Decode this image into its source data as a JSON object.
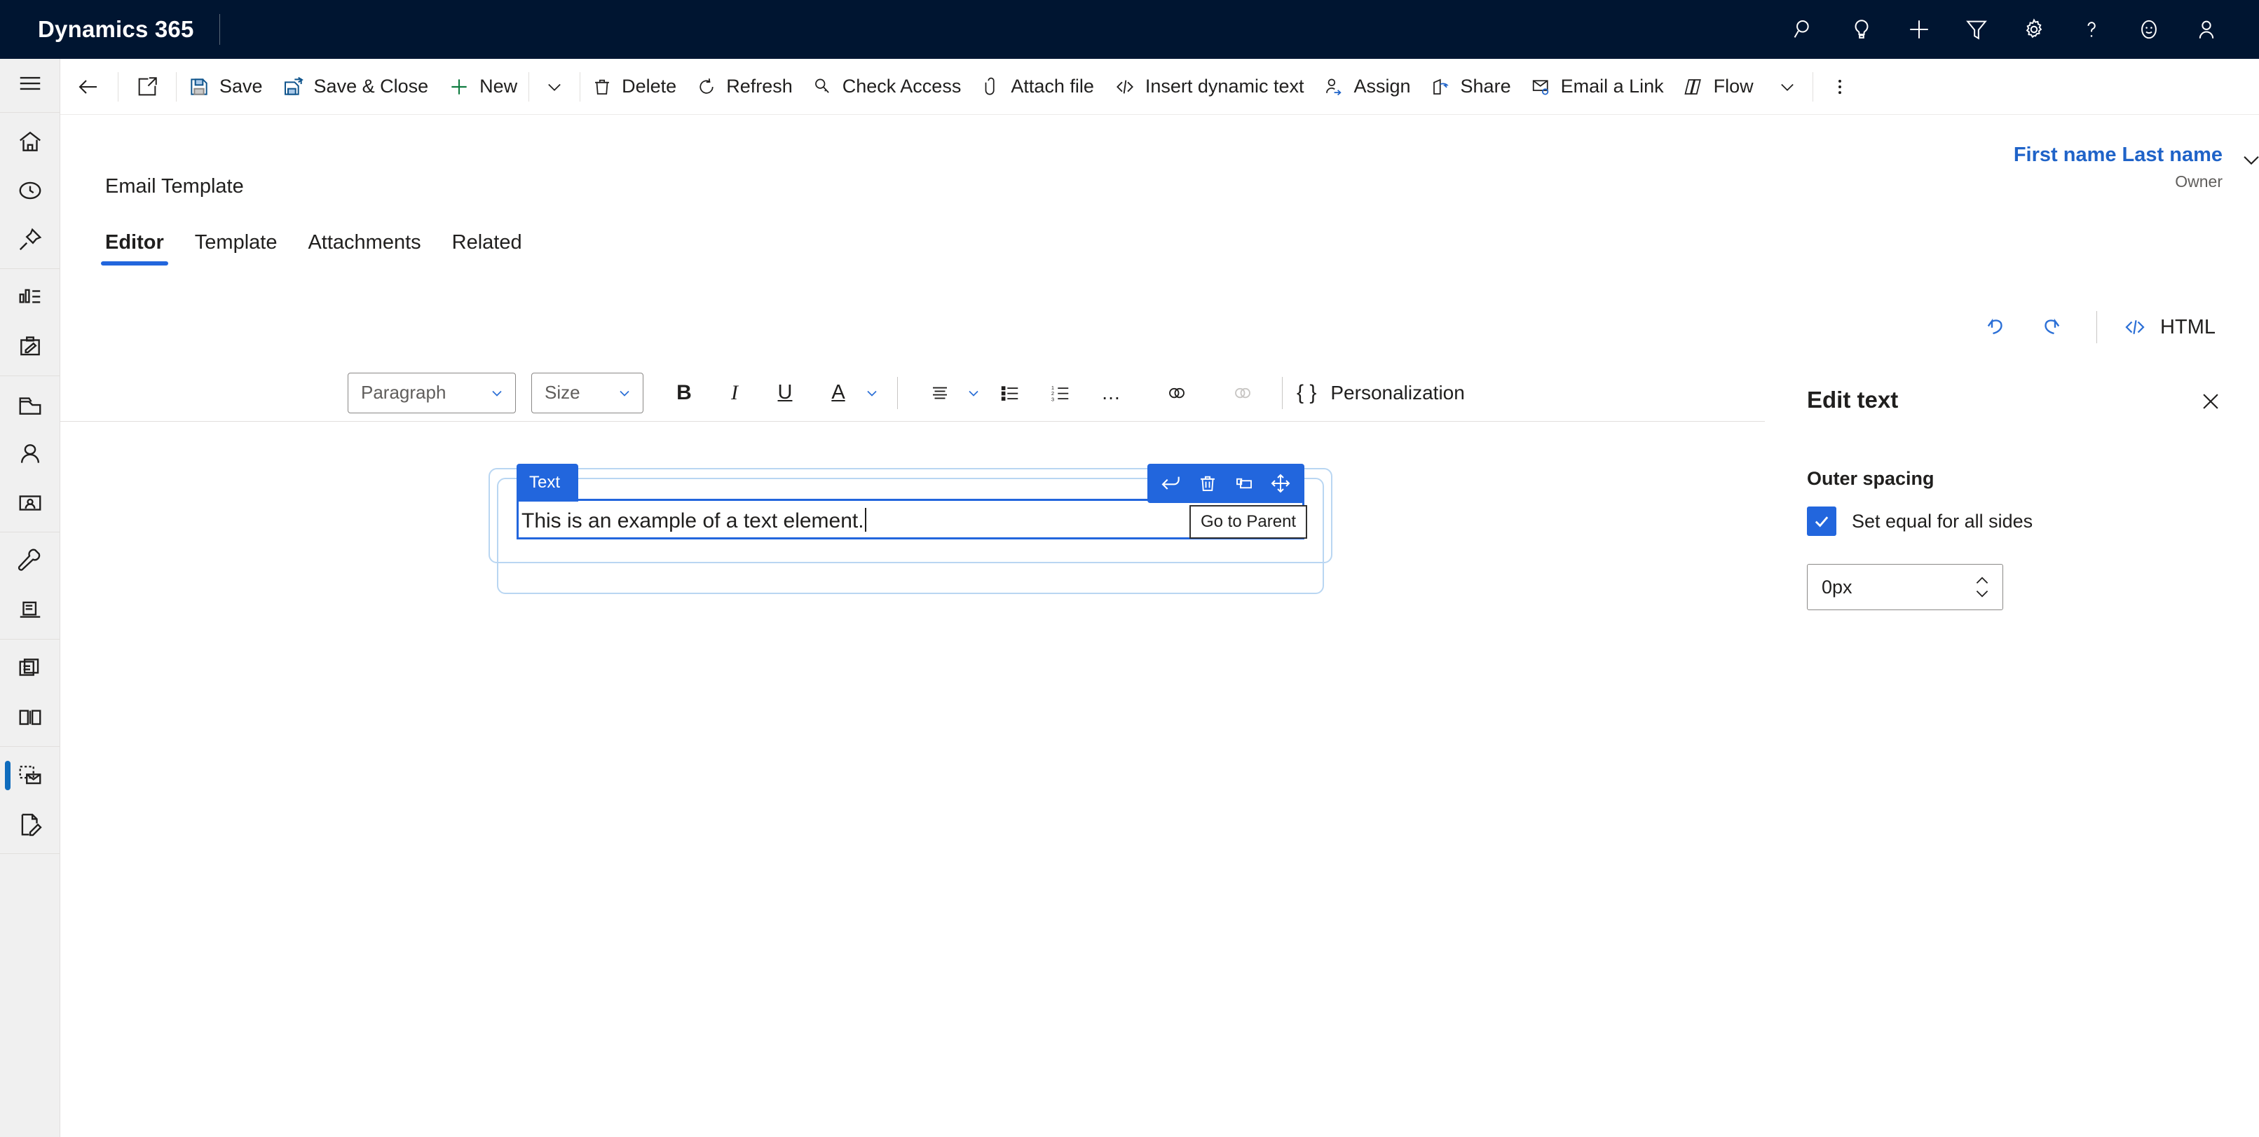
{
  "app": {
    "brand": "Dynamics 365",
    "header_bg": "#001531",
    "accent": "#2266dd",
    "link_color": "#1f63c8",
    "header_icons": [
      {
        "name": "search-icon",
        "label": "Search"
      },
      {
        "name": "lightbulb-icon",
        "label": "Insights"
      },
      {
        "name": "plus-icon",
        "label": "Quick create"
      },
      {
        "name": "filter-icon",
        "label": "Filter"
      },
      {
        "name": "gear-icon",
        "label": "Settings"
      },
      {
        "name": "question-icon",
        "label": "Help"
      },
      {
        "name": "smiley-icon",
        "label": "Feedback"
      },
      {
        "name": "person-icon",
        "label": "Account manager"
      }
    ]
  },
  "commandbar": {
    "back_label": "Back",
    "popout_label": "Open in new window",
    "items": [
      {
        "icon": "save-icon",
        "label": "Save"
      },
      {
        "icon": "save-close-icon",
        "label": "Save & Close"
      },
      {
        "icon": "plus-icon",
        "label": "New"
      },
      {
        "icon": "trash-icon",
        "label": "Delete"
      },
      {
        "icon": "refresh-icon",
        "label": "Refresh"
      },
      {
        "icon": "check-access-icon",
        "label": "Check Access"
      },
      {
        "icon": "paperclip-icon",
        "label": "Attach file"
      },
      {
        "icon": "code-icon",
        "label": "Insert dynamic text"
      },
      {
        "icon": "assign-icon",
        "label": "Assign"
      },
      {
        "icon": "share-icon",
        "label": "Share"
      },
      {
        "icon": "email-link-icon",
        "label": "Email a Link"
      },
      {
        "icon": "flow-icon",
        "label": "Flow"
      }
    ],
    "overflow_label": "More commands"
  },
  "rail": {
    "menu_label": "Site map",
    "groups": [
      [
        {
          "name": "home-icon",
          "label": "Home"
        },
        {
          "name": "recent-icon",
          "label": "Recent"
        },
        {
          "name": "pinned-icon",
          "label": "Pinned"
        }
      ],
      [
        {
          "name": "dashboard-icon",
          "label": "Dashboards"
        },
        {
          "name": "activities-icon",
          "label": "Activities"
        }
      ],
      [
        {
          "name": "accounts-icon",
          "label": "Accounts"
        },
        {
          "name": "contacts-icon",
          "label": "Contacts"
        },
        {
          "name": "leads-icon",
          "label": "Leads"
        }
      ],
      [
        {
          "name": "settings-wrench-icon",
          "label": "Settings"
        },
        {
          "name": "content-icon",
          "label": "Content"
        }
      ],
      [
        {
          "name": "library-icon",
          "label": "Library"
        },
        {
          "name": "book-icon",
          "label": "Catalog"
        }
      ],
      [
        {
          "name": "email-template-icon",
          "label": "Email templates",
          "active": true
        },
        {
          "name": "form-edit-icon",
          "label": "Forms"
        }
      ]
    ]
  },
  "form": {
    "title": "Email Template",
    "owner_name": "First name Last name",
    "owner_role": "Owner",
    "tabs": [
      {
        "label": "Editor",
        "active": true
      },
      {
        "label": "Template",
        "active": false
      },
      {
        "label": "Attachments",
        "active": false
      },
      {
        "label": "Related",
        "active": false
      }
    ]
  },
  "editor_topbar": {
    "undo_label": "Undo",
    "redo_label": "Redo",
    "html_label": "HTML"
  },
  "rte_toolbar": {
    "paragraph_value": "Paragraph",
    "size_value": "Size",
    "bold_label": "B",
    "italic_label": "I",
    "underline_label": "U",
    "font_color_label": "A",
    "align_label": "Align",
    "bullet_list_label": "Bulleted list",
    "numbered_list_label": "Numbered list",
    "more_label": "…",
    "link_label": "Insert link",
    "unlink_label": "Remove link",
    "personalization_icon": "{ }",
    "personalization_label": "Personalization"
  },
  "canvas": {
    "element_tag": "Text",
    "element_text": "This is an example of a text element.",
    "tooltip": "Go to Parent",
    "toolbar_buttons": [
      {
        "name": "go-to-parent-icon",
        "label": "Go to Parent"
      },
      {
        "name": "delete-icon",
        "label": "Delete"
      },
      {
        "name": "duplicate-icon",
        "label": "Duplicate"
      },
      {
        "name": "move-icon",
        "label": "Move"
      }
    ]
  },
  "properties": {
    "title": "Edit text",
    "close_label": "Close",
    "section_label": "Outer spacing",
    "checkbox_label": "Set equal for all sides",
    "checkbox_checked": true,
    "spacing_value": "0px"
  }
}
